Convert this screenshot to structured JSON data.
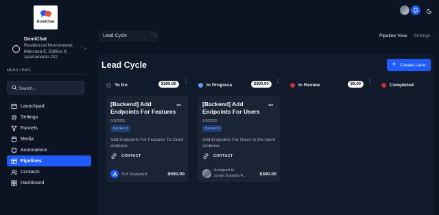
{
  "app": {
    "logo_text": "DomiChat"
  },
  "workspace": {
    "name": "DomiChat",
    "address": "Residencial Monumental, Manzana E, Edificio 8, Apartamento 202"
  },
  "sidebar": {
    "menu_heading": "MENU LINKS",
    "search_placeholder": "Search...",
    "items": [
      {
        "label": "Launchpad",
        "icon": "launchpad-icon",
        "active": false
      },
      {
        "label": "Settings",
        "icon": "gear-icon",
        "active": false
      },
      {
        "label": "Funnels",
        "icon": "funnel-icon",
        "active": false
      },
      {
        "label": "Media",
        "icon": "media-icon",
        "active": false
      },
      {
        "label": "Automations",
        "icon": "automation-icon",
        "active": false
      },
      {
        "label": "Pipelines",
        "icon": "pipeline-icon",
        "active": true
      },
      {
        "label": "Contacts",
        "icon": "contacts-icon",
        "active": false
      },
      {
        "label": "Dashboard",
        "icon": "dashboard-icon",
        "active": false
      }
    ]
  },
  "header": {
    "board_select": "Lead Cycle",
    "tab_pipeline": "Pipeline View",
    "tab_settings": "Settings",
    "accent": "#1f5bff"
  },
  "board": {
    "title": "Lead Cycle",
    "create_lane_label": "Create Lane",
    "lanes": [
      {
        "name": "To Do",
        "color": "#1f2a3d",
        "amount": "$500.00"
      },
      {
        "name": "In Progress",
        "color": "#5b9bf0",
        "amount": "$300.00"
      },
      {
        "name": "In Review",
        "color": "#c1362f",
        "amount": "$0.00"
      },
      {
        "name": "Completed",
        "color": "#c1362f",
        "amount": ""
      }
    ],
    "cards": [
      {
        "title": "[Backend] Add Endpoints For Features",
        "date": "6/8/2025",
        "tag": "Backend",
        "description": "Add Endpoints For Features To Client Ambiorix",
        "contact_label": "CONTACT",
        "assignee": "Not Assigned",
        "price": "$500.00"
      },
      {
        "title": "[Backend] Add Endpoints For Users",
        "date": "6/8/2025",
        "tag": "Backend",
        "description": "Add Endpoints For Users to the client Ambiorix",
        "contact_label": "CONTACT",
        "assigned_to_label": "Assigned to",
        "assignee": "Jordan Bobadilla R...",
        "price": "$300.00"
      }
    ]
  }
}
